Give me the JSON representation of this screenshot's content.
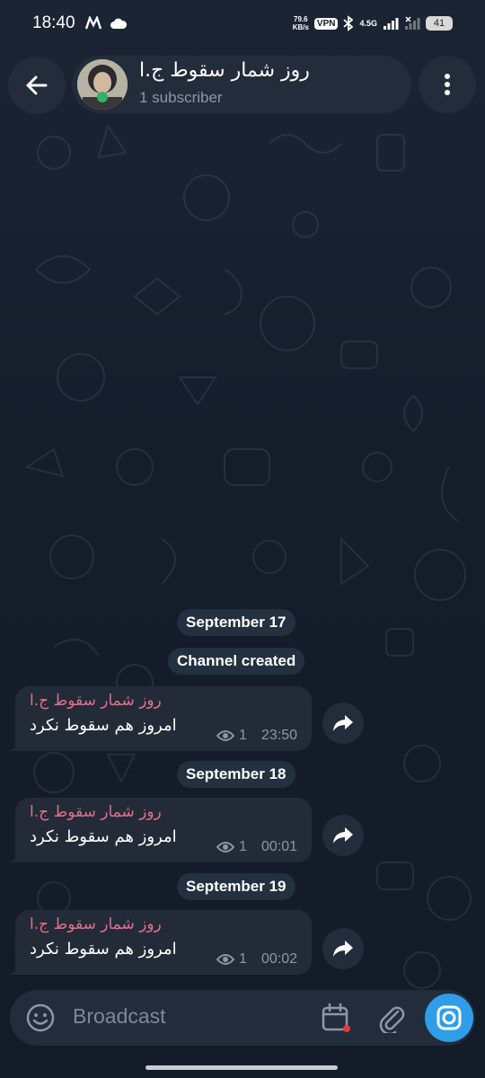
{
  "status_bar": {
    "time": "18:40",
    "net_speed_value": "79.6",
    "net_speed_unit": "KB/s",
    "vpn_label": "VPN",
    "network_type": "4.5G",
    "battery": "41",
    "icons": [
      "m-icon",
      "cloud-icon",
      "bluetooth-icon",
      "signal-icon",
      "no-signal-icon"
    ]
  },
  "header": {
    "title": "روز شمار سقوط ج.ا",
    "subtitle": "1 subscriber"
  },
  "date_pills": {
    "sep17": "September 17",
    "created": "Channel created",
    "sep18": "September 18",
    "sep19": "September 19"
  },
  "messages": [
    {
      "sender": "روز شمار سقوط ج.ا",
      "text": "امروز هم سقوط نکرد",
      "views": "1",
      "time": "23:50"
    },
    {
      "sender": "روز شمار سقوط ج.ا",
      "text": "امروز هم سقوط نکرد",
      "views": "1",
      "time": "00:01"
    },
    {
      "sender": "روز شمار سقوط ج.ا",
      "text": "امروز هم سقوط نکرد",
      "views": "1",
      "time": "00:02"
    }
  ],
  "input": {
    "placeholder": "Broadcast"
  },
  "colors": {
    "accent": "#2f9ee8",
    "sender": "#e66f8c",
    "bubble": "#222b37",
    "background": "#141d2a"
  }
}
